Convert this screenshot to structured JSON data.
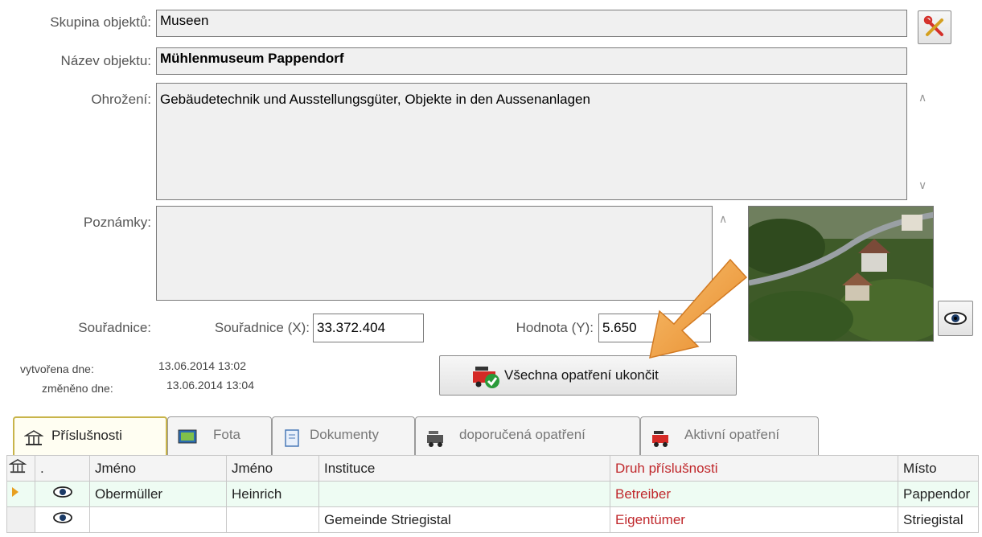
{
  "form": {
    "group_label": "Skupina objektů:",
    "group_value": "Museen",
    "name_label": "Název objektu:",
    "name_value": "Mühlenmuseum Pappendorf",
    "threat_label": "Ohrožení:",
    "threat_value": "Gebäudetechnik und Ausstellungsgüter, Objekte in den Aussenanlagen",
    "notes_label": "Poznámky:",
    "notes_value": "",
    "coords_label": "Souřadnice:",
    "coord_x_label": "Souřadnice (X):",
    "coord_x_value": "33.372.404",
    "coord_y_label": "Hodnota (Y):",
    "coord_y_value": "5.650",
    "created_label": "vytvořena dne:",
    "created_value": "13.06.2014 13:02",
    "changed_label": "změněno dne:",
    "changed_value": "13.06.2014 13:04"
  },
  "actions": {
    "end_all_label": "Všechna opatření ukončit"
  },
  "tabs": [
    {
      "label": "Příslušnosti",
      "icon": "building-icon"
    },
    {
      "label": "Fota",
      "icon": "picture-icon"
    },
    {
      "label": "Dokumenty",
      "icon": "document-icon"
    },
    {
      "label": "doporučená opatření",
      "icon": "truck-icon"
    },
    {
      "label": "Aktivní opatření",
      "icon": "fire-truck-icon"
    }
  ],
  "grid": {
    "columns": [
      "",
      ".",
      "Jméno",
      "Jméno",
      "Instituce",
      "Druh příslušnosti",
      "Místo"
    ],
    "rows": [
      {
        "first_name": "Obermüller",
        "last_name": "Heinrich",
        "institution": "",
        "type": "Betreiber",
        "place": "Pappendor"
      },
      {
        "first_name": "",
        "last_name": "",
        "institution": "Gemeinde Striegistal",
        "type": "Eigentümer",
        "place": "Striegistal"
      }
    ]
  },
  "colors": {
    "accent_red": "#c0282c",
    "arrow_orange": "#f0a040",
    "selected_row": "#eefcf3"
  }
}
